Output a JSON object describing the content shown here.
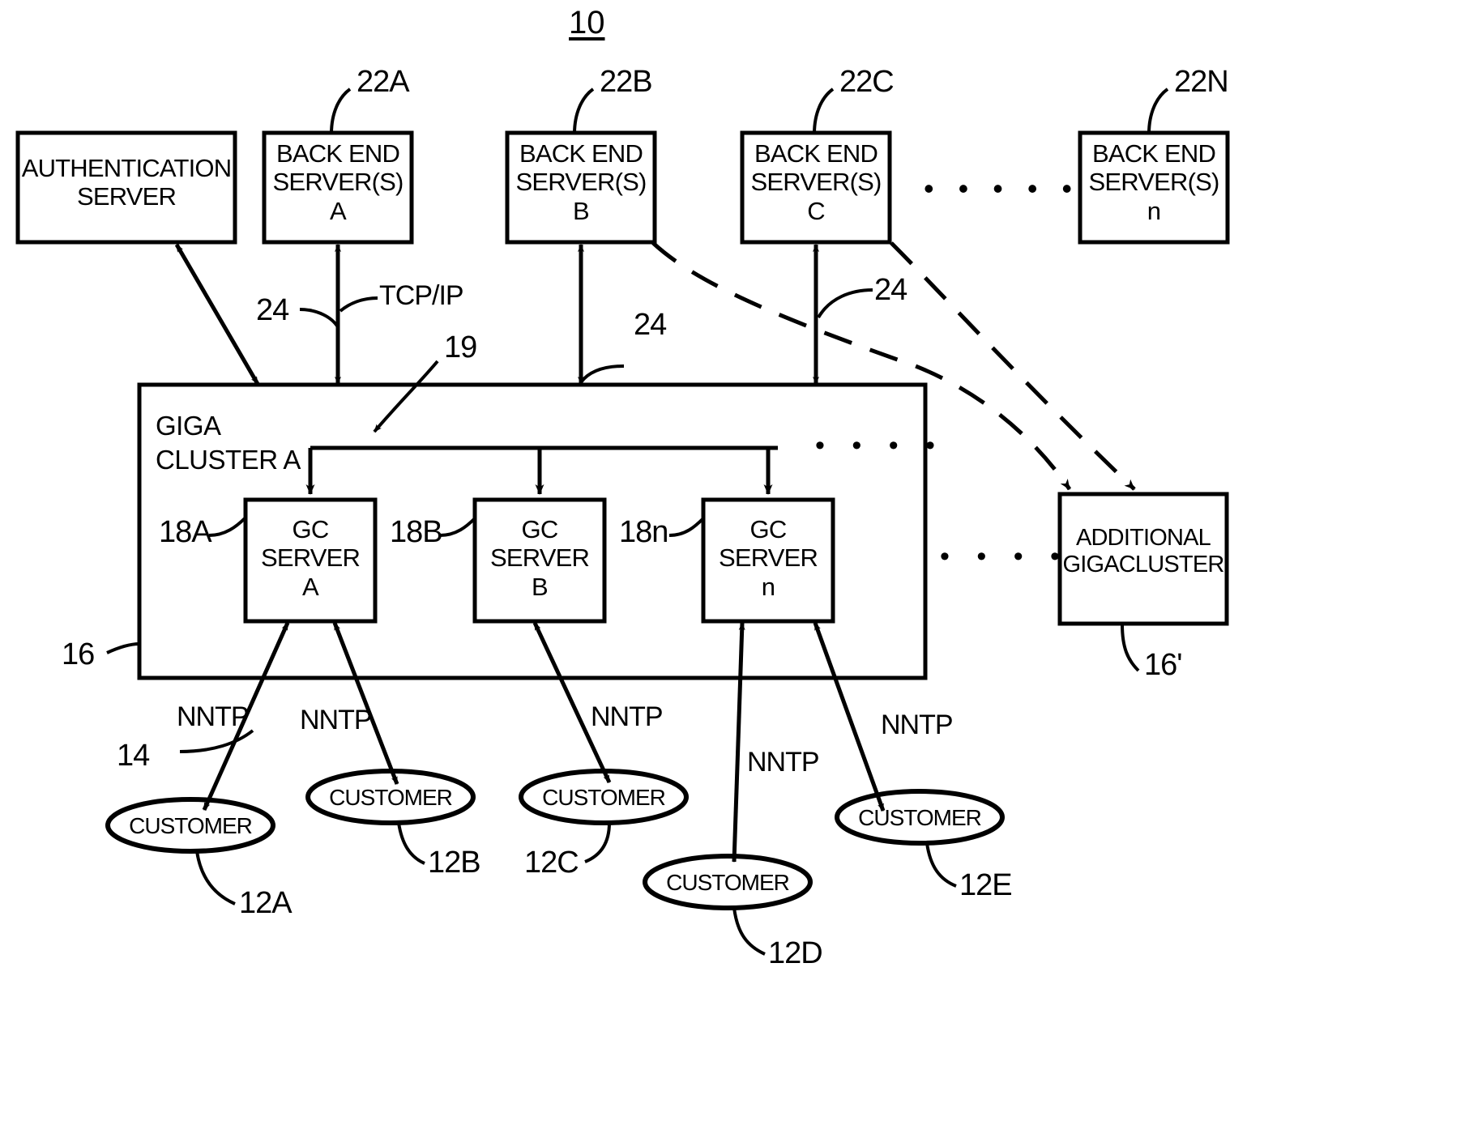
{
  "figure": {
    "number": "10"
  },
  "boxes": {
    "auth_server": {
      "label": "AUTHENTICATION\nSERVER"
    },
    "back_end_a": {
      "label": "BACK END\nSERVER(S)\nA",
      "ref": "22A"
    },
    "back_end_b": {
      "label": "BACK END\nSERVER(S)\nB",
      "ref": "22B"
    },
    "back_end_c": {
      "label": "BACK END\nSERVER(S)\nC",
      "ref": "22C"
    },
    "back_end_n": {
      "label": "BACK END\nSERVER(S)\nn",
      "ref": "22N"
    },
    "giga_cluster": {
      "label": "GIGA\nCLUSTER A",
      "ref": "16",
      "bus_ref": "19"
    },
    "gc_server_a": {
      "label": "GC\nSERVER\nA",
      "ref": "18A"
    },
    "gc_server_b": {
      "label": "GC\nSERVER\nB",
      "ref": "18B"
    },
    "gc_server_n": {
      "label": "GC\nSERVER\nn",
      "ref": "18n"
    },
    "additional_gigacluster": {
      "label": "ADDITIONAL\nGIGACLUSTER",
      "ref": "16'"
    }
  },
  "customers": [
    {
      "label": "CUSTOMER",
      "ref": "12A"
    },
    {
      "label": "CUSTOMER",
      "ref": "12B"
    },
    {
      "label": "CUSTOMER",
      "ref": "12C"
    },
    {
      "label": "CUSTOMER",
      "ref": "12D"
    },
    {
      "label": "CUSTOMER",
      "ref": "12E"
    }
  ],
  "links": {
    "tcpip_label": "TCP/IP",
    "tcpip_ref_a": "24",
    "tcpip_ref_b": "24",
    "tcpip_ref_c": "24",
    "nntp_1": "NNTP",
    "nntp_2": "NNTP",
    "nntp_3": "NNTP",
    "nntp_4": "NNTP",
    "nntp_5": "NNTP",
    "nntp_ref": "14"
  },
  "ellipsis": {
    "top_row": "• • • • •",
    "cluster_bus": "• • • •",
    "cluster_servers": "• • • •"
  },
  "colors": {
    "ink": "#000000",
    "paper": "#ffffff"
  }
}
